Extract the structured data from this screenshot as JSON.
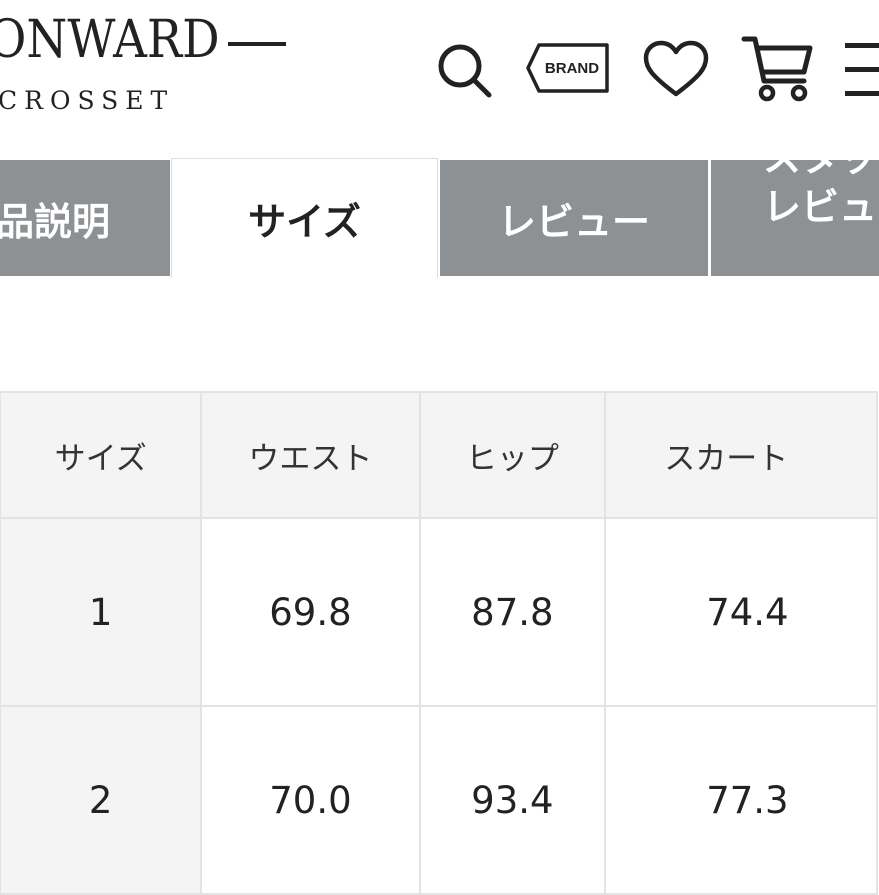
{
  "header": {
    "logo_main": "ONWARD",
    "logo_sub": "CROSSET",
    "brand_button_label": "BRAND",
    "icons": [
      "search-icon",
      "brand-tag-icon",
      "heart-icon",
      "cart-icon",
      "menu-icon"
    ]
  },
  "tabs": [
    {
      "label": "品説明",
      "active": false
    },
    {
      "label": "サイズ",
      "active": true
    },
    {
      "label": "レビュー",
      "active": false
    },
    {
      "label_line1": "スタッ",
      "label_line2": "レビュ",
      "active": false
    }
  ],
  "size_table": {
    "headers": [
      "サイズ",
      "ウエスト",
      "ヒップ",
      "スカート"
    ],
    "rows": [
      [
        "1",
        "69.8",
        "87.8",
        "74.4"
      ],
      [
        "2",
        "70.0",
        "93.4",
        "77.3"
      ]
    ]
  },
  "colors": {
    "tab_inactive_bg": "#8e9194",
    "table_header_bg": "#f4f4f4",
    "table_border": "#e3e3e3",
    "text": "#222222"
  }
}
